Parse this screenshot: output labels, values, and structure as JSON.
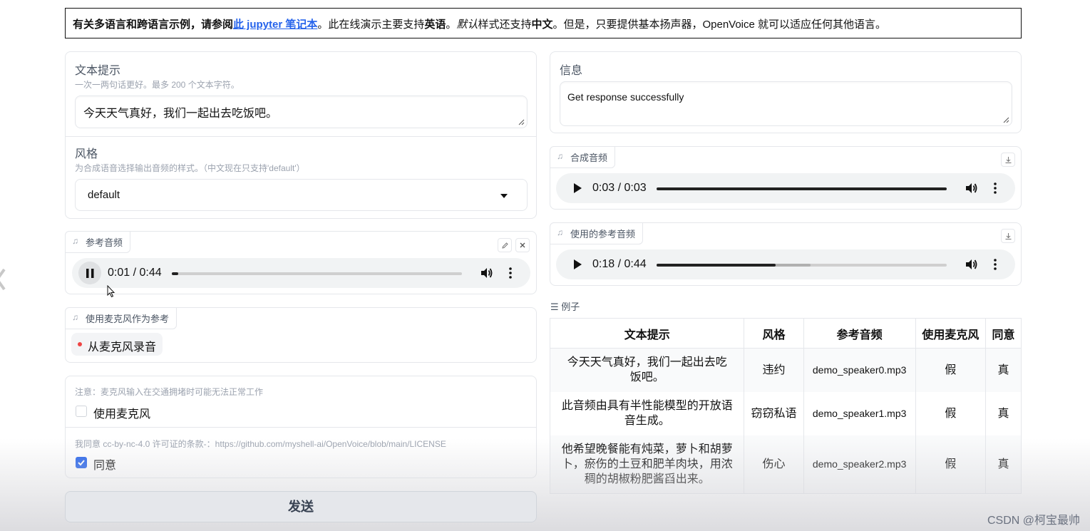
{
  "banner": {
    "p1": "有关多语言和跨语言示例，请参阅",
    "link": "此 jupyter 笔记本",
    "p2": "。此在线演示主要支持",
    "b1": "英语",
    "p3": "。",
    "i1": "默认",
    "p4": "样式还支持",
    "b2": "中文",
    "p5": "。但是，只要提供基本扬声器，OpenVoice 就可以适应任何其他语言。"
  },
  "text_prompt": {
    "label": "文本提示",
    "hint": "一次一两句话更好。最多 200 个文本字符。",
    "value": "今天天气真好，我们一起出去吃饭吧。"
  },
  "style": {
    "label": "风格",
    "hint": "为合成语音选择输出音频的样式。（中文现在只支持'default'）",
    "value": "default"
  },
  "reference_audio": {
    "label": "参考音频",
    "time": "0:01 / 0:44",
    "progress": 0.023
  },
  "mic_ref": {
    "label": "使用麦克风作为参考",
    "record_label": "从麦克风录音"
  },
  "notice": {
    "mic_note": "注意：麦克风输入在交通拥堵时可能无法正常工作",
    "mic_checkbox": "使用麦克风",
    "mic_checked": false,
    "license_note": "我同意 cc-by-nc-4.0 许可证的条款-：https://github.com/myshell-ai/OpenVoice/blob/main/LICENSE",
    "agree_checkbox": "同意",
    "agree_checked": true
  },
  "send_label": "发送",
  "info": {
    "label": "信息",
    "value": "Get response successfully"
  },
  "synth_audio": {
    "label": "合成音频",
    "time": "0:03 / 0:03",
    "progress": 1.0
  },
  "used_ref_audio": {
    "label": "使用的参考音频",
    "time": "0:18 / 0:44",
    "progress": 0.41,
    "buffered": 0.53
  },
  "examples": {
    "label": "例子",
    "headers": [
      "文本提示",
      "风格",
      "参考音频",
      "使用麦克风",
      "同意"
    ],
    "rows": [
      [
        "今天天气真好，我们一起出去吃饭吧。",
        "违约",
        "demo_speaker0.mp3",
        "假",
        "真"
      ],
      [
        "此音频由具有半性能模型的开放语音生成。",
        "窃窃私语",
        "demo_speaker1.mp3",
        "假",
        "真"
      ],
      [
        "他希望晚餐能有炖菜，萝卜和胡萝卜，瘀伤的土豆和肥羊肉块，用浓稠的胡椒粉肥酱舀出来。",
        "伤心",
        "demo_speaker2.mp3",
        "假",
        "真"
      ]
    ]
  },
  "watermark": "CSDN @柯宝最帅",
  "colors": {
    "accent": "#2563eb",
    "record_dot": "#ef4444"
  }
}
